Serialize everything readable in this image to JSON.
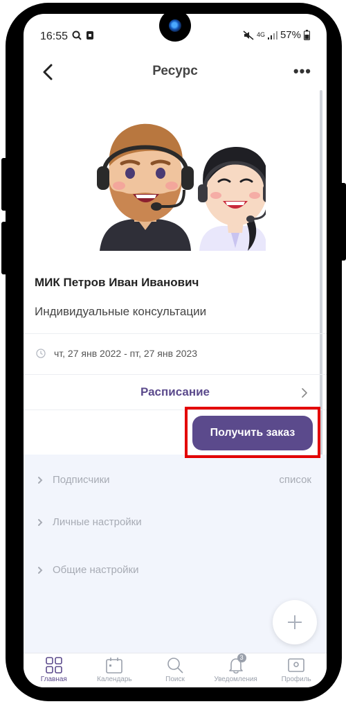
{
  "status_bar": {
    "time": "16:55",
    "network": "4G",
    "battery": "57%"
  },
  "header": {
    "title": "Ресурс",
    "more_icon": "more-dots-icon"
  },
  "resource": {
    "name": "МИК Петров Иван Иванович",
    "description": "Индивидуальные консультации",
    "period": "чт, 27 янв 2022 - пт, 27 янв 2023"
  },
  "schedule": {
    "label": "Расписание"
  },
  "order_button": {
    "label": "Получить заказ"
  },
  "settings": [
    {
      "label": "Подписчики",
      "right": "список"
    },
    {
      "label": "Личные настройки"
    },
    {
      "label": "Общие настройки"
    }
  ],
  "tabs": [
    {
      "label": "Главная",
      "icon": "grid-icon"
    },
    {
      "label": "Календарь",
      "icon": "calendar-icon"
    },
    {
      "label": "Поиск",
      "icon": "search-icon"
    },
    {
      "label": "Уведомления",
      "icon": "bell-icon",
      "badge": "3"
    },
    {
      "label": "Профиль",
      "icon": "profile-icon"
    }
  ],
  "colors": {
    "accent": "#5b4a8c",
    "highlight": "#e30000",
    "settings_bg": "#f2f5fc"
  }
}
